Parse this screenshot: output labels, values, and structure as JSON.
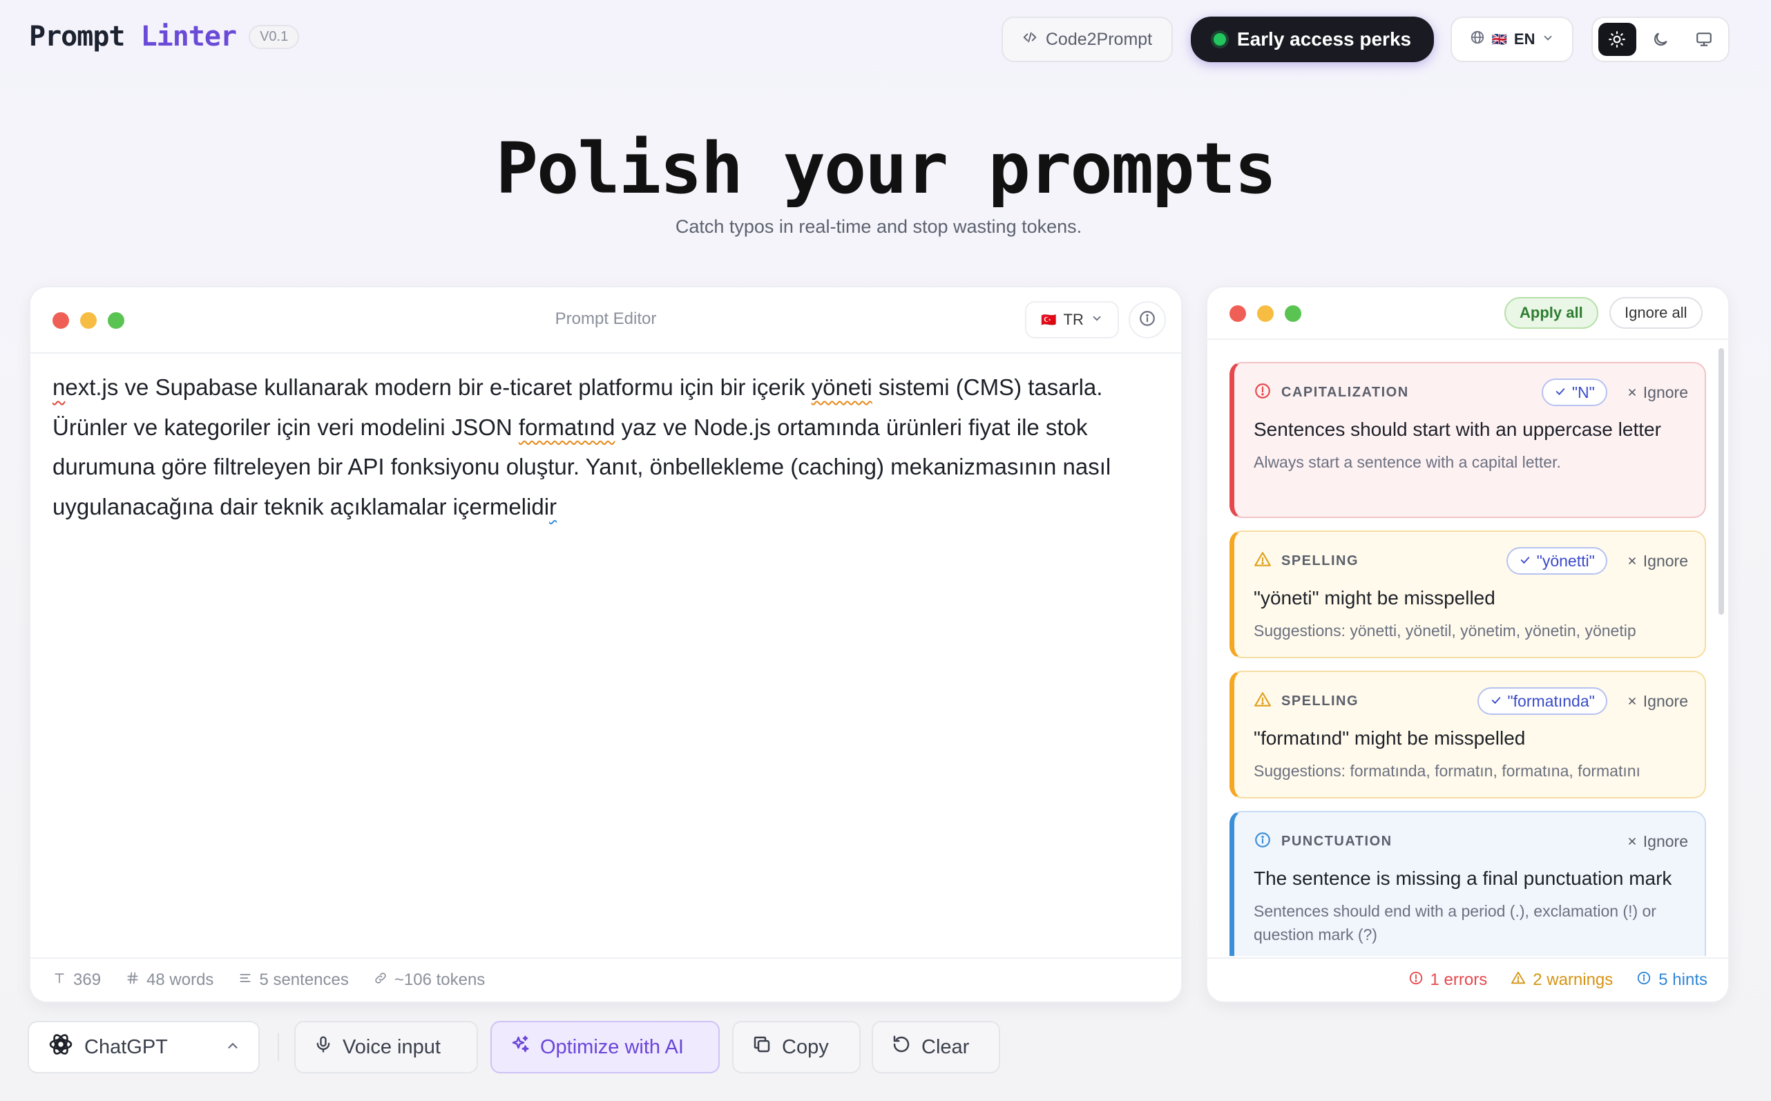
{
  "header": {
    "logo_part1": "Prompt",
    "logo_part2": "Linter",
    "version": "V0.1",
    "code2prompt": "Code2Prompt",
    "perks": "Early access perks",
    "lang_flag": "🇬🇧",
    "lang": "EN",
    "theme_active": "light"
  },
  "hero": {
    "title": "Polish your prompts",
    "subtitle": "Catch typos in real-time and stop wasting tokens."
  },
  "editor": {
    "title": "Prompt Editor",
    "lang_flag": "🇹🇷",
    "lang": "TR",
    "text": {
      "p1": "n",
      "p2": "ext.js ve Supabase kullanarak modern bir e-ticaret platformu için bir içerik ",
      "p3": "yöneti",
      "p4": " sistemi (CMS) tasarla. Ürünler ve kategoriler için veri modelini JSON ",
      "p5": "formatınd",
      "p6": " yaz ve Node.js ortamında ürünleri fiyat ile stok durumuna göre filtreleyen bir API fonksiyonu oluştur. Yanıt, önbellekleme (caching) mekanizmasının nasıl uygulanacağına dair teknik açıklamalar içermelidi",
      "p7": "r"
    },
    "stats": {
      "chars": "369",
      "words": "48 words",
      "sentences": "5 sentences",
      "tokens": "~106 tokens"
    }
  },
  "issues": {
    "apply_all": "Apply all",
    "ignore_all": "Ignore all",
    "ignore_label": "Ignore",
    "cards": [
      {
        "category": "CAPITALIZATION",
        "fix": "\"N\"",
        "title": "Sentences should start with an uppercase letter",
        "desc": "Always start a sentence with a capital letter."
      },
      {
        "category": "SPELLING",
        "fix": "\"yönetti\"",
        "title": "\"yöneti\" might be misspelled",
        "desc": "Suggestions: yönetti, yönetil, yönetim, yönetin, yönetip"
      },
      {
        "category": "SPELLING",
        "fix": "\"formatında\"",
        "title": "\"formatınd\" might be misspelled",
        "desc": "Suggestions: formatında, formatın, formatına, formatını"
      },
      {
        "category": "PUNCTUATION",
        "title": "The sentence is missing a final punctuation mark",
        "desc": "Sentences should end with a period (.), exclamation (!) or question mark (?)"
      }
    ],
    "summary": {
      "errors": "1 errors",
      "warnings": "2 warnings",
      "hints": "5 hints"
    }
  },
  "toolbar": {
    "model": "ChatGPT",
    "voice": "Voice input",
    "optimize": "Optimize with AI",
    "copy": "Copy",
    "clear": "Clear"
  },
  "colors": {
    "accent": "#6a4bd8",
    "error": "#e5484d",
    "warning": "#f5a623",
    "hint": "#3b8fd9"
  }
}
